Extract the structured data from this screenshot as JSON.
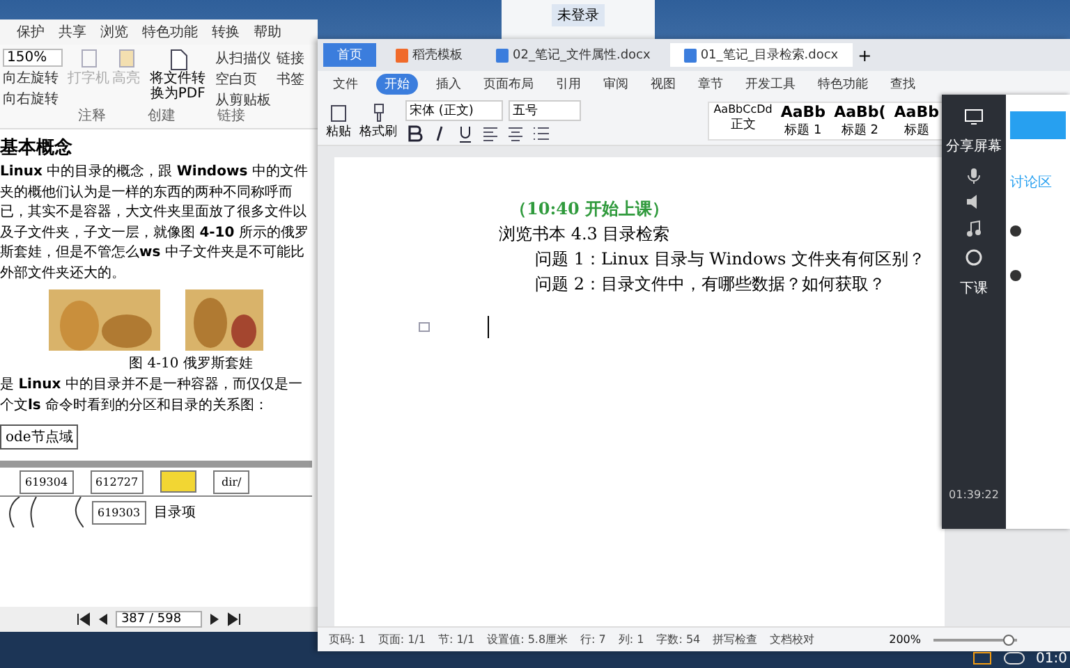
{
  "pdf_window": {
    "menu": [
      "保护",
      "共享",
      "浏览",
      "特色功能",
      "转换",
      "帮助"
    ],
    "zoom": "150%",
    "rotate": [
      "向左旋转",
      "向右旋转"
    ],
    "tools": [
      {
        "label": "打字机",
        "disabled": true
      },
      {
        "label": "高亮",
        "disabled": true
      }
    ],
    "convert": "将文件转换为PDF",
    "create": [
      "从扫描仪",
      "空白页",
      "从剪贴板"
    ],
    "links": [
      "链接",
      "书签"
    ],
    "groups": [
      "注释",
      "创建",
      "链接"
    ],
    "heading": "基本概念",
    "paragraph_1": "**Linux** 中的目录的概念，跟 **Windows** 中的文件夹的概他们认为是一样的东西的两种不同称呼而已，其实不是容器，大文件夹里面放了很多文件以及子文件夹，子文一层，就像图 **4-10** 所示的俄罗斯套娃，但是不管怎么**ws** 中子文件夹是不可能比外部文件夹还大的。",
    "caption": "图 4-10 俄罗斯套娃",
    "paragraph_2": "是 **Linux** 中的目录并不是一种容器，而仅仅是一个文**ls** 命令时看到的分区和目录的关系图：",
    "diagram": {
      "label": "ode节点域",
      "cells": [
        {
          "text": "619304",
          "highlight": false
        },
        {
          "text": "612727",
          "highlight": false
        },
        {
          "text": "",
          "highlight": true
        },
        {
          "text": "dir/",
          "highlight": false
        }
      ],
      "sub_cell": "619303",
      "sub_label": "目录项"
    },
    "page": "387 / 598"
  },
  "top_window": {
    "login": "未登录"
  },
  "wps_window": {
    "tabs": [
      {
        "label": "首页",
        "kind": "home",
        "selected": false
      },
      {
        "label": "稻壳模板",
        "kind": "template",
        "selected": false
      },
      {
        "label": "02_笔记_文件属性.docx",
        "kind": "doc",
        "selected": false
      },
      {
        "label": "01_笔记_目录检索.docx",
        "kind": "doc",
        "selected": true
      }
    ],
    "new_tab": "+",
    "menu": [
      {
        "label": "文件",
        "selected": false
      },
      {
        "label": "开始",
        "selected": true
      },
      {
        "label": "插入",
        "selected": false
      },
      {
        "label": "页面布局",
        "selected": false
      },
      {
        "label": "引用",
        "selected": false
      },
      {
        "label": "审阅",
        "selected": false
      },
      {
        "label": "视图",
        "selected": false
      },
      {
        "label": "章节",
        "selected": false
      },
      {
        "label": "开发工具",
        "selected": false
      },
      {
        "label": "特色功能",
        "selected": false
      },
      {
        "label": "查找",
        "selected": false
      }
    ],
    "clipboard": [
      "粘贴",
      "格式刷"
    ],
    "font": "宋体 (正文)",
    "size": "五号",
    "styles": [
      {
        "sample": "AaBbCcDd",
        "label": "正文"
      },
      {
        "sample": "AaBb",
        "label": "标题 1"
      },
      {
        "sample": "AaBb(",
        "label": "标题 2"
      },
      {
        "sample": "AaBb",
        "label": "标题"
      }
    ],
    "lines": [
      {
        "kind": "note",
        "text": "（10:40 开始上课）"
      },
      {
        "kind": "plain",
        "text": "浏览书本  4.3  目录检索"
      },
      {
        "kind": "indent",
        "text": "问题 1：Linux 目录与 Windows 文件夹有何区别？"
      },
      {
        "kind": "indent",
        "text": "问题 2：目录文件中，有哪些数据？如何获取？"
      }
    ],
    "status": [
      "页码: 1",
      "页面: 1/1",
      "节: 1/1",
      "设置值: 5.8厘米",
      "行: 7",
      "列: 1",
      "字数: 54",
      "拼写检查",
      "文档校对"
    ],
    "zoom": "200%",
    "zoom_slider": {
      "level": 0.9
    }
  },
  "class_panel": {
    "tools": [
      "分享屏幕",
      "下课"
    ],
    "timer": "01:39:22",
    "section": "讨论区"
  },
  "taskbar": {
    "clock": "01:0"
  }
}
